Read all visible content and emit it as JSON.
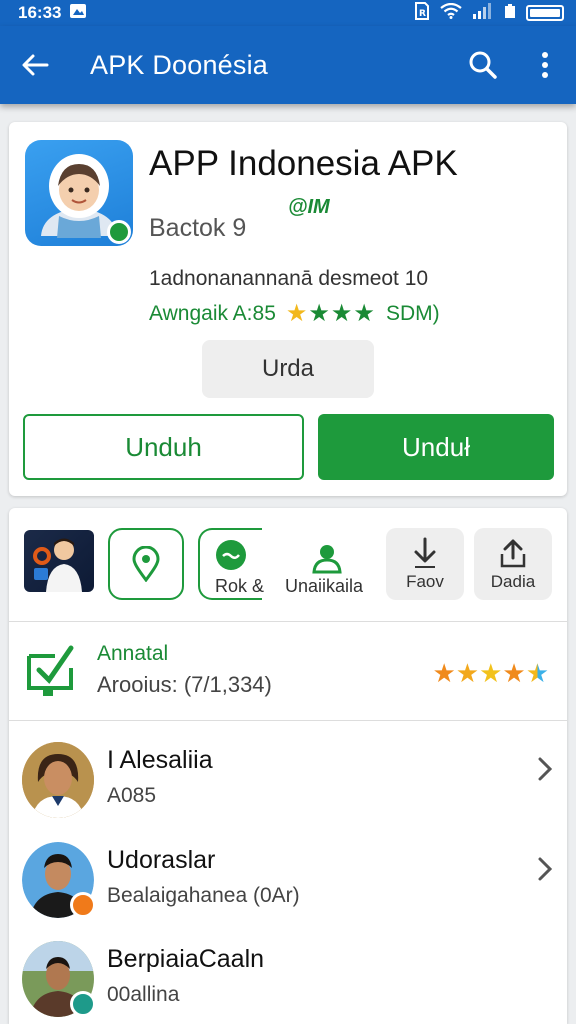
{
  "status_bar": {
    "time": "16:33",
    "colors": {
      "bar": "#1565c0"
    },
    "icons": [
      "image-icon",
      "sim-icon",
      "wifi-icon",
      "signal-icon",
      "battery-icon"
    ]
  },
  "app_bar": {
    "title": "APK Doonésia",
    "back_icon": "arrow-left-icon",
    "search_icon": "search-icon",
    "menu_icon": "more-vert-icon"
  },
  "app_card": {
    "title": "APP Indonesia  APK",
    "tag": "@IM",
    "developer": "Bactok  9",
    "description": "1adnonanannanā desmeot 10",
    "rating_label": "Awngaik A:85",
    "rating_suffix": "SDM)",
    "stars": "★★★★",
    "button_grey": "Urda",
    "button_outline": "Unduh",
    "button_solid": "Unduł",
    "colors": {
      "accent": "#1e9a3c",
      "star": "#f2b81c"
    }
  },
  "actions": {
    "items": [
      {
        "label": "",
        "icon": "location-pin-icon"
      },
      {
        "label": "Rok &",
        "icon": "share-icon"
      },
      {
        "label": "Unaiikaila",
        "icon": "person-icon"
      },
      {
        "label": "Faov",
        "icon": "download-icon"
      },
      {
        "label": "Dadia",
        "icon": "upload-icon"
      }
    ]
  },
  "rating": {
    "title": "Annatal",
    "subtitle": "Arooius: (7/1,334)",
    "stars": "★★★★★",
    "value": 4.5
  },
  "people": [
    {
      "name": "I Alesaliia",
      "sub": "A085"
    },
    {
      "name": "Udoraslar",
      "sub": "Bealaigahanea (0Ar)"
    },
    {
      "name": "BerpiaiaCaaln",
      "sub": "00allina"
    }
  ]
}
